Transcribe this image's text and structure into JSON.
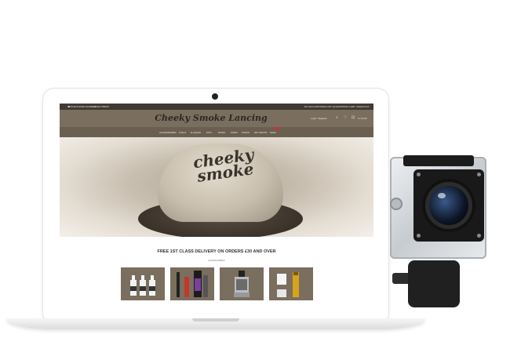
{
  "site": {
    "topbar": {
      "left_info": "OUR PHONE NUMBER",
      "phone": "01524 555607",
      "links": [
        "MY ACCOUNT",
        "WISH LIST (0)",
        "SHOPPING CART",
        "CHECKOUT"
      ]
    },
    "header": {
      "logo": "Cheeky Smoke Lancing",
      "login": "Login / Register",
      "cart_amount": "0 / £0.00"
    },
    "nav": [
      "ACCESSORIES",
      "COILS",
      "E-LIQUID",
      "KITS",
      "MODS",
      "PODS",
      "TANKS",
      "NIC SHOTS",
      "SALE"
    ],
    "hero": {
      "cap_text": "cheeky smoke"
    },
    "delivery_banner": "FREE 1ST CLASS DELIVERY ON ORDERS £30 AND OVER",
    "categories_title": "CATEGORIES"
  },
  "colors": {
    "header_bg": "#7a6e5f",
    "nav_bg": "#6a5f51",
    "topbar_bg": "#3f3a33",
    "sale_badge": "#d92c2c"
  }
}
